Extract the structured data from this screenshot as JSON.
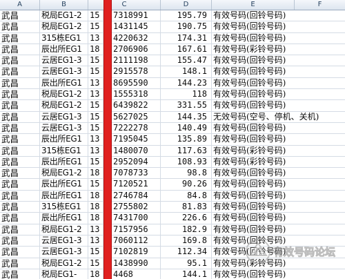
{
  "columns": [
    "A",
    "B",
    "C",
    "D",
    "E",
    "F"
  ],
  "rows": [
    [
      "武昌",
      "税局EG1-2",
      "15",
      "7318991",
      "195.79",
      "有效号码(回铃号码)"
    ],
    [
      "武昌",
      "税局EG1-2",
      "15",
      "1431145",
      "190.75",
      "有效号码(回铃号码)"
    ],
    [
      "武昌",
      "315栋EG1",
      "13",
      "4220632",
      "174.31",
      "有效号码(回铃号码)"
    ],
    [
      "武昌",
      "辰出所EG1",
      "18",
      "2706906",
      "167.61",
      "有效号码(彩铃号码)"
    ],
    [
      "武昌",
      "云居EG1-3",
      "15",
      "2111198",
      "155.47",
      "有效号码(回铃号码)"
    ],
    [
      "武昌",
      "云居EG1-3",
      "15",
      "2915578",
      "148.1",
      "有效号码(回铃号码)"
    ],
    [
      "武昌",
      "辰出所EG1",
      "13",
      "8695590",
      "144.23",
      "有效号码(回铃号码)"
    ],
    [
      "武昌",
      "税局EG1-2",
      "13",
      "1555318",
      "118",
      "有效号码(回铃号码)"
    ],
    [
      "武昌",
      "税局EG1-2",
      "15",
      "6439822",
      "331.55",
      "有效号码(回铃号码)"
    ],
    [
      "武昌",
      "云居EG1-3",
      "15",
      "5627025",
      "144.35",
      "无效号码(空号、停机、关机)"
    ],
    [
      "武昌",
      "云居EG1-3",
      "15",
      "7222278",
      "140.49",
      "有效号码(回铃号码)"
    ],
    [
      "武昌",
      "辰出所EG1",
      "13",
      "7195045",
      "135.89",
      "有效号码(回铃号码)"
    ],
    [
      "武昌",
      "315栋EG1",
      "13",
      "1480070",
      "117.63",
      "有效号码(彩铃号码)"
    ],
    [
      "武昌",
      "辰出所EG1",
      "15",
      "2952094",
      "108.93",
      "有效号码(彩铃号码)"
    ],
    [
      "武昌",
      "税局EG1-2",
      "18",
      "7078733",
      "98.8",
      "有效号码(回铃号码)"
    ],
    [
      "武昌",
      "辰出所EG1",
      "15",
      "7120521",
      "90.26",
      "有效号码(回铃号码)"
    ],
    [
      "武昌",
      "辰出所EG1",
      "18",
      "2746784",
      "84.8",
      "有效号码(回铃号码)"
    ],
    [
      "武昌",
      "315栋EG1",
      "18",
      "2755802",
      "81.83",
      "有效号码(回铃号码)"
    ],
    [
      "武昌",
      "辰出所EG1",
      "18",
      "7431700",
      "226.6",
      "有效号码(回铃号码)"
    ],
    [
      "武昌",
      "税局EG1-2",
      "13",
      "7157956",
      "182.9",
      "有效号码(回铃号码)"
    ],
    [
      "武昌",
      "云居EG1-3",
      "13",
      "7060112",
      "169.8",
      "有效号码(回铃号码)"
    ],
    [
      "武昌",
      "云居EG1-3",
      "15",
      "7102819",
      "112.34",
      "有效号码(回铃号码)"
    ],
    [
      "武昌",
      "税局EG1-2",
      "15",
      "1438990",
      "95.1",
      "有效号码(彩铃号码)"
    ],
    [
      "武昌",
      "税局EG1-",
      "18",
      "4468",
      "144.1",
      "有效号码(回铃号码)"
    ]
  ],
  "watermark": {
    "text": "有效号码论坛"
  },
  "colors": {
    "highlight_bar": "#e02020",
    "header_bg": "#dde5ef",
    "grid_line": "#d4dbe4"
  }
}
